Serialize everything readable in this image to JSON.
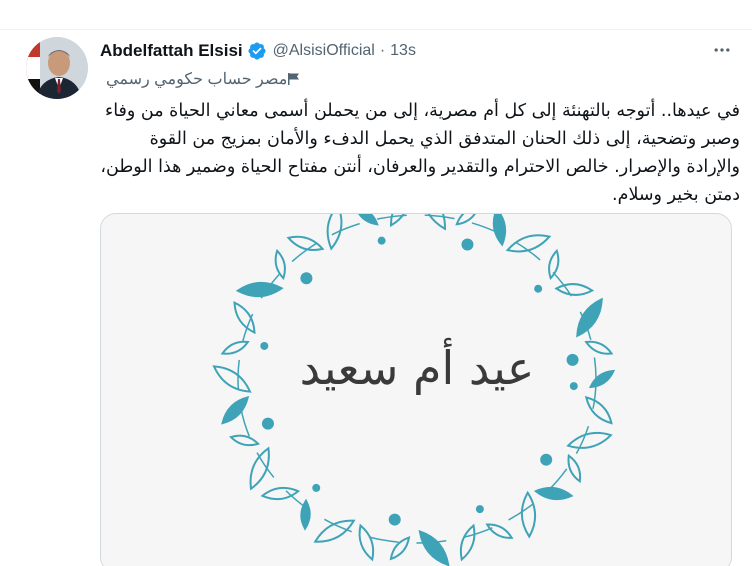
{
  "tweet": {
    "author_name": "Abdelfattah Elsisi",
    "handle": "@AlsisiOfficial",
    "separator": "·",
    "time": "13s",
    "account_label": "مصر حساب حكومي رسمي",
    "text": "في عيدها.. أتوجه بالتهنئة إلى كل أم مصرية، إلى من يحملن أسمى معاني الحياة من وفاء وصبر وتضحية، إلى ذلك الحنان المتدفق الذي يحمل الدفء والأمان بمزيج من القوة والإرادة والإصرار. خالص الاحترام والتقدير والعرفان، أنتن مفتاح الحياة وضمير هذا الوطن، دمتن بخير وسلام."
  },
  "media": {
    "card_text": "عيد أم سعيد",
    "wreath_color": "#3fa3b8",
    "background_color": "#f6f6f6"
  },
  "icons": {
    "verified": "verified-badge-icon",
    "more": "more-options-icon",
    "flag": "government-flag-icon"
  },
  "colors": {
    "verified_blue": "#1d9bf0",
    "secondary_text": "#536471",
    "primary_text": "#0f1419"
  }
}
